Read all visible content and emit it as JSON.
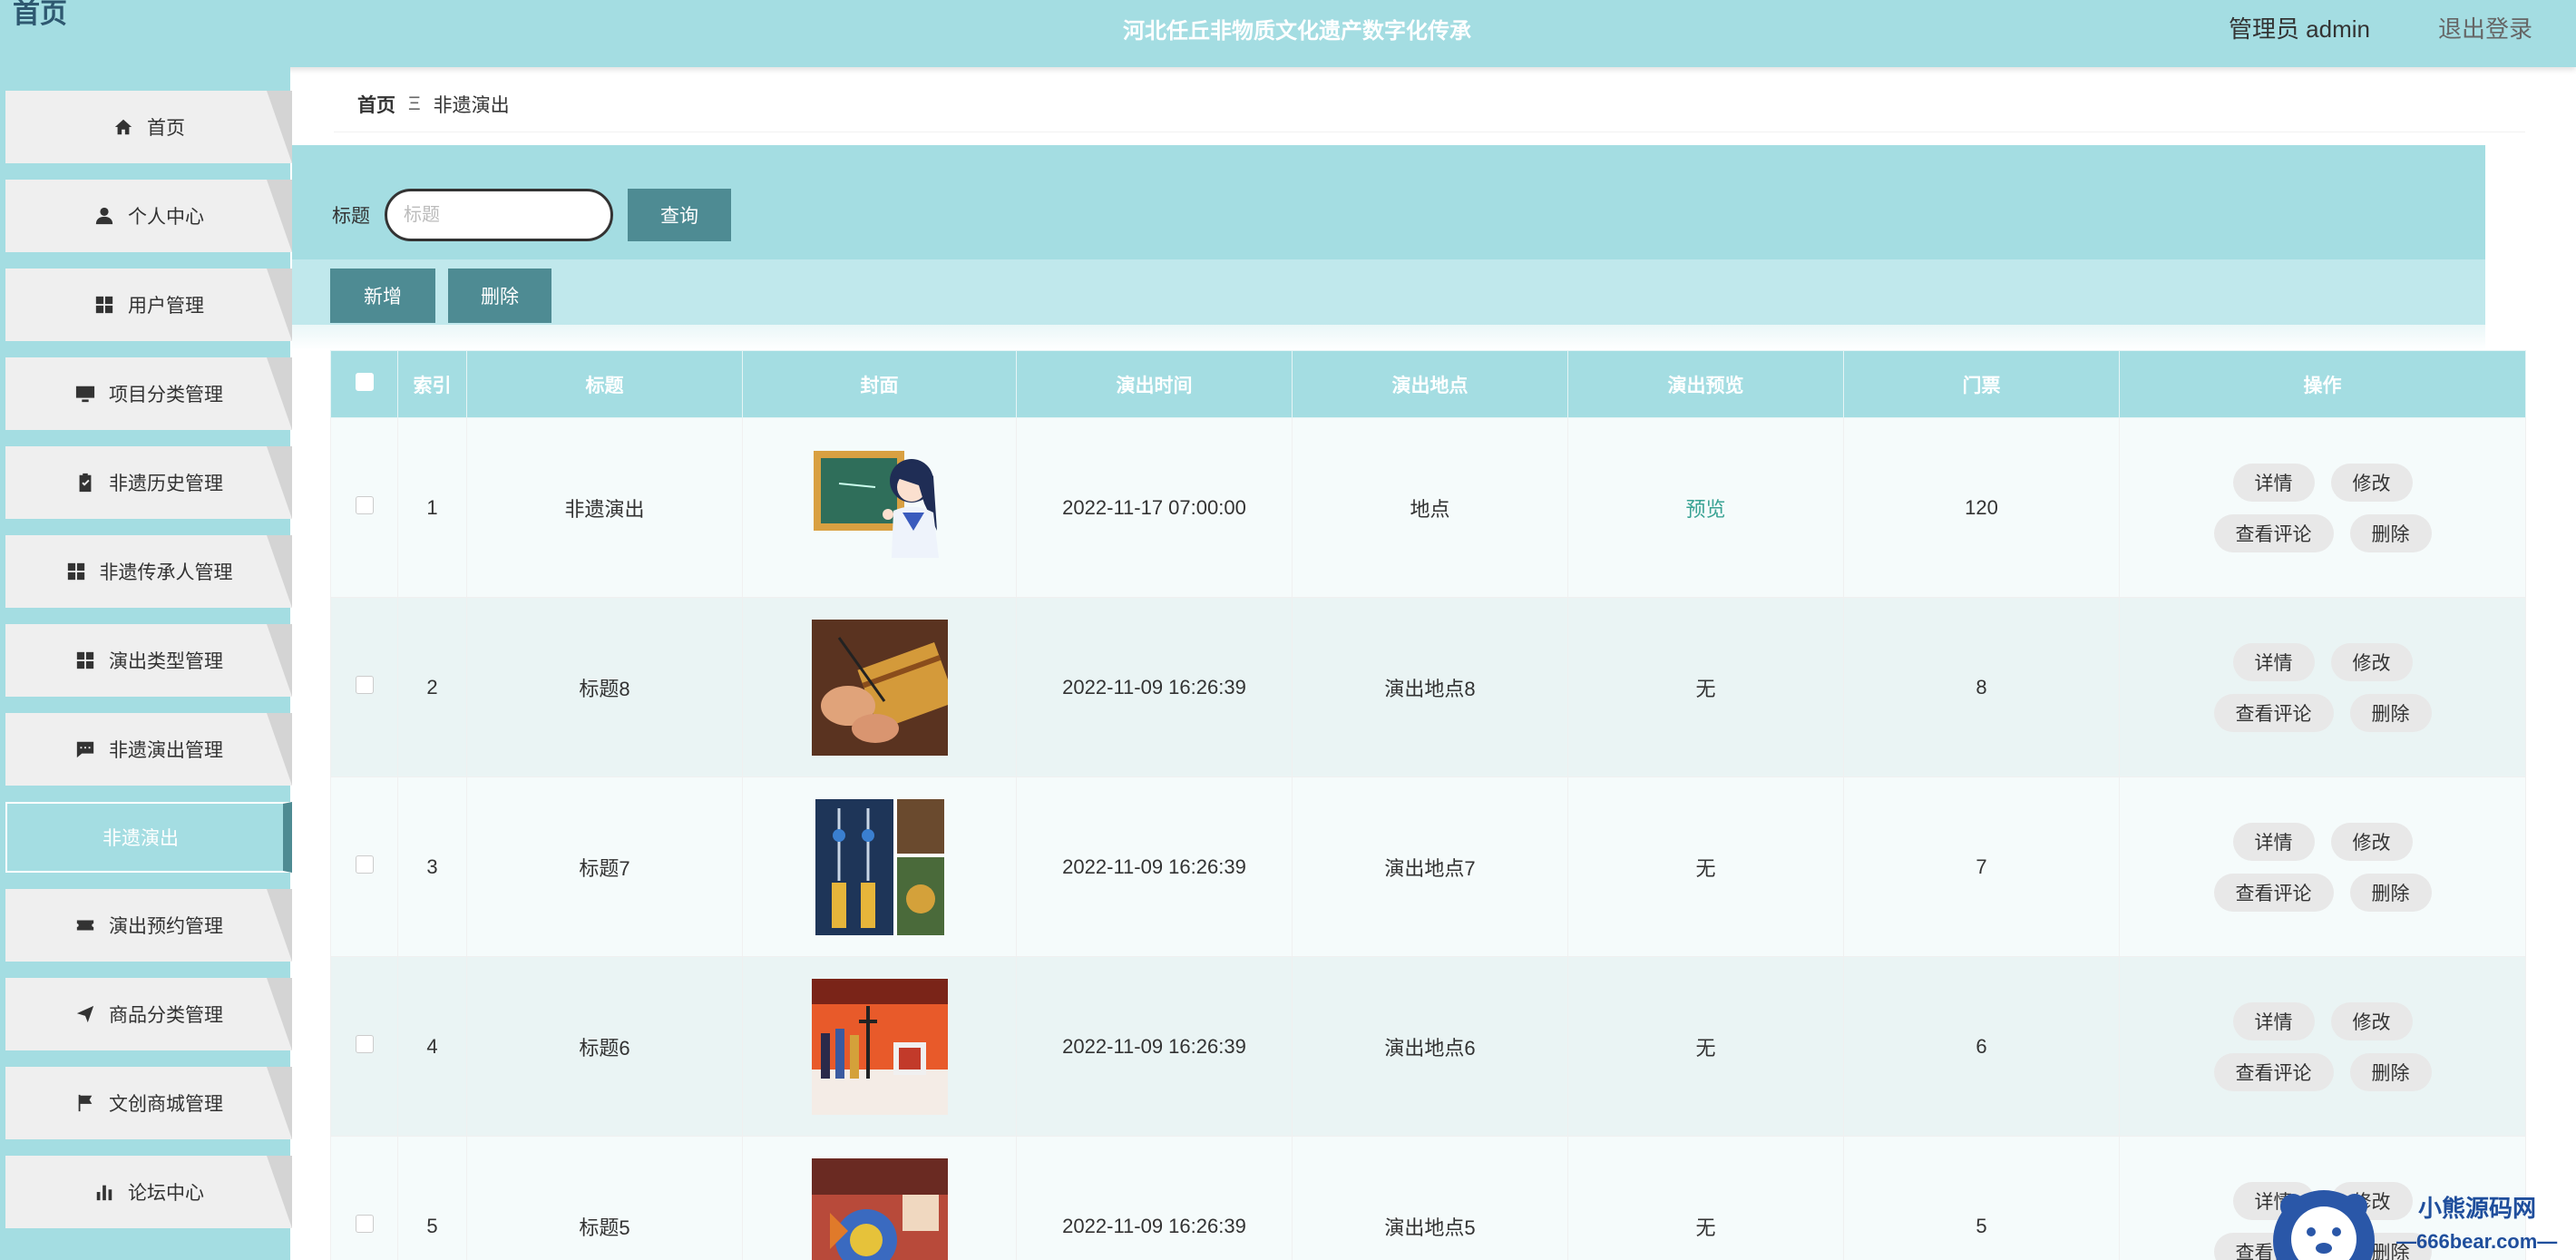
{
  "header": {
    "logo": "首页",
    "title": "河北任丘非物质文化遗产数字化传承",
    "admin_label": "管理员 admin",
    "logout_label": "退出登录"
  },
  "sidebar": {
    "items": [
      {
        "label": "首页",
        "icon": "home-icon"
      },
      {
        "label": "个人中心",
        "icon": "user-icon"
      },
      {
        "label": "用户管理",
        "icon": "grid-icon"
      },
      {
        "label": "项目分类管理",
        "icon": "monitor-icon"
      },
      {
        "label": "非遗历史管理",
        "icon": "clipboard-icon"
      },
      {
        "label": "非遗传承人管理",
        "icon": "grid-icon"
      },
      {
        "label": "演出类型管理",
        "icon": "grid-icon"
      },
      {
        "label": "非遗演出管理",
        "icon": "comment-icon"
      },
      {
        "label": "非遗演出",
        "icon": ""
      },
      {
        "label": "演出预约管理",
        "icon": "ticket-icon"
      },
      {
        "label": "商品分类管理",
        "icon": "send-icon"
      },
      {
        "label": "文创商城管理",
        "icon": "flag-icon"
      },
      {
        "label": "论坛中心",
        "icon": "bar-chart-icon"
      }
    ]
  },
  "breadcrumb": {
    "home": "首页",
    "separator": "Ξ",
    "current": "非遗演出"
  },
  "search": {
    "label": "标题",
    "placeholder": "标题",
    "query_button": "查询"
  },
  "actions": {
    "add": "新增",
    "delete": "删除"
  },
  "table": {
    "headers": [
      "索引",
      "标题",
      "封面",
      "演出时间",
      "演出地点",
      "演出预览",
      "门票",
      "操作"
    ],
    "rows": [
      {
        "index": "1",
        "title": "非遗演出",
        "time": "2022-11-17 07:00:00",
        "place": "地点",
        "preview": "预览",
        "ticket": "120"
      },
      {
        "index": "2",
        "title": "标题8",
        "time": "2022-11-09 16:26:39",
        "place": "演出地点8",
        "preview": "无",
        "ticket": "8"
      },
      {
        "index": "3",
        "title": "标题7",
        "time": "2022-11-09 16:26:39",
        "place": "演出地点7",
        "preview": "无",
        "ticket": "7"
      },
      {
        "index": "4",
        "title": "标题6",
        "time": "2022-11-09 16:26:39",
        "place": "演出地点6",
        "preview": "无",
        "ticket": "6"
      },
      {
        "index": "5",
        "title": "标题5",
        "time": "2022-11-09 16:26:39",
        "place": "演出地点5",
        "preview": "无",
        "ticket": "5"
      }
    ],
    "ops": {
      "detail": "详情",
      "edit": "修改",
      "comments": "查看评论",
      "delete": "删除"
    }
  },
  "watermark": {
    "name": "小熊源码网",
    "url": "—666bear.com—"
  },
  "colors": {
    "primary": "#a4dde2",
    "button": "#4e8b93",
    "preview_link": "#3aa394"
  }
}
